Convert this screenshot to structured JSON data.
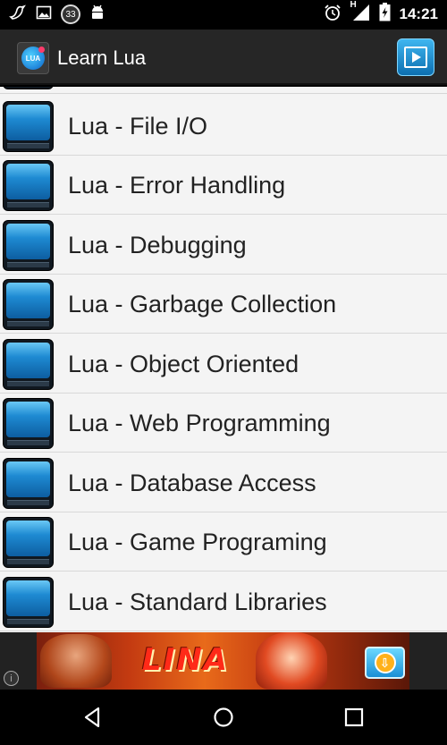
{
  "status_bar": {
    "time": "14:21",
    "notification_count": "33",
    "network": "H",
    "icons": [
      "bird-icon",
      "image-icon",
      "notification-count-badge",
      "android-icon",
      "alarm-icon",
      "network-h-icon",
      "signal-icon",
      "battery-charging-icon"
    ]
  },
  "action_bar": {
    "title": "Learn Lua",
    "app_icon_text": "LUA",
    "background": "#262626"
  },
  "list": {
    "items": [
      {
        "label": "Lua - File I/O"
      },
      {
        "label": "Lua - Error Handling"
      },
      {
        "label": "Lua - Debugging"
      },
      {
        "label": "Lua - Garbage Collection"
      },
      {
        "label": "Lua - Object Oriented"
      },
      {
        "label": "Lua - Web Programming"
      },
      {
        "label": "Lua - Database Access"
      },
      {
        "label": "Lua - Game Programing"
      },
      {
        "label": "Lua - Standard Libraries"
      }
    ],
    "item_icon": "book-icon",
    "background": "#f4f4f4",
    "divider": "#d8d8d8"
  },
  "ad": {
    "banner_text": "LINA",
    "info_icon_text": "i",
    "download_icon": "download-icon"
  },
  "nav_bar": {
    "buttons": [
      "back-icon",
      "home-icon",
      "recent-apps-icon"
    ]
  }
}
